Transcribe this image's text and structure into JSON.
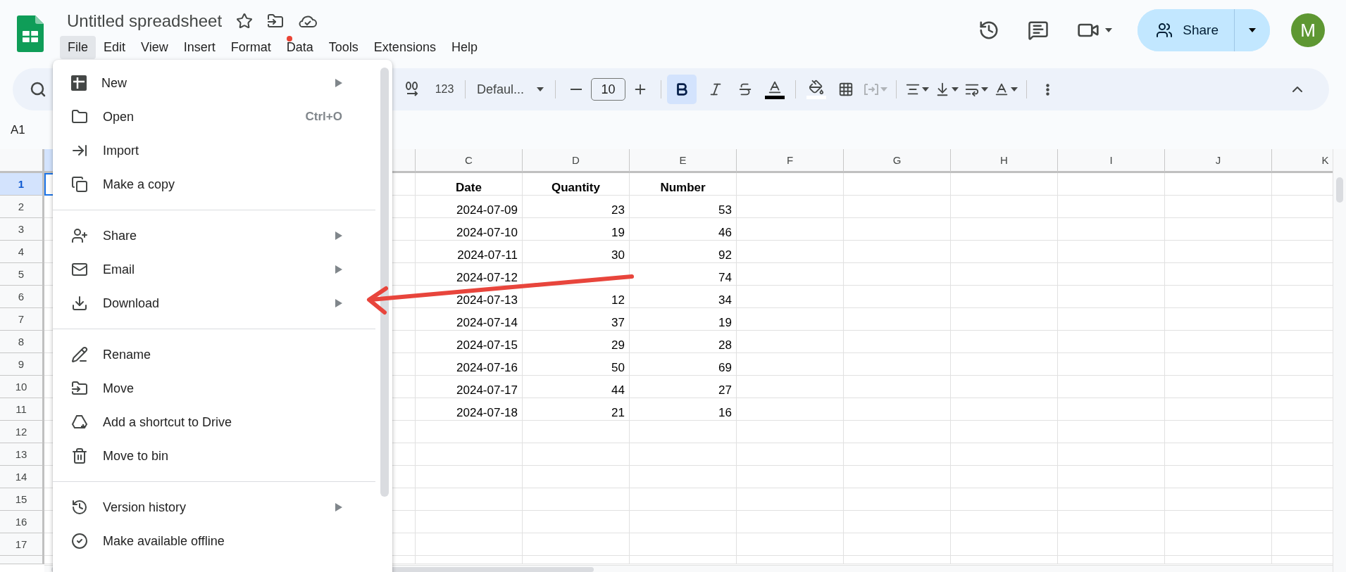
{
  "document": {
    "title": "Untitled spreadsheet"
  },
  "menu_bar": [
    {
      "label": "File",
      "selected": true,
      "notification": false
    },
    {
      "label": "Edit",
      "selected": false,
      "notification": false
    },
    {
      "label": "View",
      "selected": false,
      "notification": false
    },
    {
      "label": "Insert",
      "selected": false,
      "notification": false
    },
    {
      "label": "Format",
      "selected": false,
      "notification": false
    },
    {
      "label": "Data",
      "selected": false,
      "notification": true
    },
    {
      "label": "Tools",
      "selected": false,
      "notification": false
    },
    {
      "label": "Extensions",
      "selected": false,
      "notification": false
    },
    {
      "label": "Help",
      "selected": false,
      "notification": false
    }
  ],
  "share_button": {
    "label": "Share"
  },
  "avatar": {
    "initial": "M"
  },
  "toolbar": {
    "number_format": "123",
    "font": "Defaul...",
    "font_size": "10",
    "bold": {
      "selected": true
    },
    "italic": {
      "selected": false
    },
    "strikethrough": {
      "selected": false
    },
    "merge": {
      "disabled": true
    }
  },
  "name_box": "A1",
  "columns": [
    {
      "selected": true
    },
    {
      "selected": false
    },
    {
      "label": "C",
      "selected": false
    },
    {
      "label": "D",
      "selected": false
    },
    {
      "label": "E",
      "selected": false
    },
    {
      "label": "F",
      "selected": false
    },
    {
      "label": "G",
      "selected": false
    },
    {
      "label": "H",
      "selected": false
    },
    {
      "label": "I",
      "selected": false
    },
    {
      "label": "J",
      "selected": false
    },
    {
      "label": "K",
      "selected": false
    }
  ],
  "rows": [
    {
      "number": "1",
      "selected": true,
      "kind": "header",
      "col_c": "Date",
      "col_d": "Quantity",
      "col_e": "Number"
    },
    {
      "number": "2",
      "selected": false,
      "kind": "data",
      "col_c": "2024-07-09",
      "col_d": "23",
      "col_e": "53"
    },
    {
      "number": "3",
      "selected": false,
      "kind": "data",
      "col_c": "2024-07-10",
      "col_d": "19",
      "col_e": "46"
    },
    {
      "number": "4",
      "selected": false,
      "kind": "data",
      "col_c": "2024-07-11",
      "col_d": "30",
      "col_e": "92"
    },
    {
      "number": "5",
      "selected": false,
      "kind": "data",
      "col_c": "2024-07-12",
      "col_e": "74"
    },
    {
      "number": "6",
      "selected": false,
      "kind": "data",
      "col_c": "2024-07-13",
      "col_d": "12",
      "col_e": "34"
    },
    {
      "number": "7",
      "selected": false,
      "kind": "data",
      "col_c": "2024-07-14",
      "col_d": "37",
      "col_e": "19"
    },
    {
      "number": "8",
      "selected": false,
      "kind": "data",
      "col_c": "2024-07-15",
      "col_d": "29",
      "col_e": "28"
    },
    {
      "number": "9",
      "selected": false,
      "kind": "data",
      "col_c": "2024-07-16",
      "col_d": "50",
      "col_e": "69"
    },
    {
      "number": "10",
      "selected": false,
      "kind": "data",
      "col_c": "2024-07-17",
      "col_d": "44",
      "col_e": "27"
    },
    {
      "number": "11",
      "selected": false,
      "kind": "data",
      "col_c": "2024-07-18",
      "col_d": "21",
      "col_e": "16"
    },
    {
      "number": "12",
      "selected": false,
      "kind": "data"
    },
    {
      "number": "13",
      "selected": false,
      "kind": "data"
    },
    {
      "number": "14",
      "selected": false,
      "kind": "data"
    },
    {
      "number": "15",
      "selected": false,
      "kind": "data"
    },
    {
      "number": "16",
      "selected": false,
      "kind": "data"
    },
    {
      "number": "17",
      "selected": false,
      "kind": "data"
    }
  ],
  "file_menu": {
    "sections": [
      [
        {
          "label": "New",
          "submenu": true
        },
        {
          "label": "Open",
          "shortcut": "Ctrl+O",
          "submenu": false
        },
        {
          "label": "Import",
          "submenu": false
        },
        {
          "label": "Make a copy",
          "submenu": false
        }
      ],
      [
        {
          "label": "Share",
          "submenu": true
        },
        {
          "label": "Email",
          "submenu": true
        },
        {
          "label": "Download",
          "submenu": true
        }
      ],
      [
        {
          "label": "Rename",
          "submenu": false
        },
        {
          "label": "Move",
          "submenu": false
        },
        {
          "label": "Add a shortcut to Drive",
          "submenu": false
        },
        {
          "label": "Move to bin",
          "submenu": false
        }
      ],
      [
        {
          "label": "Version history",
          "submenu": true
        },
        {
          "label": "Make available offline",
          "submenu": false
        }
      ]
    ]
  }
}
